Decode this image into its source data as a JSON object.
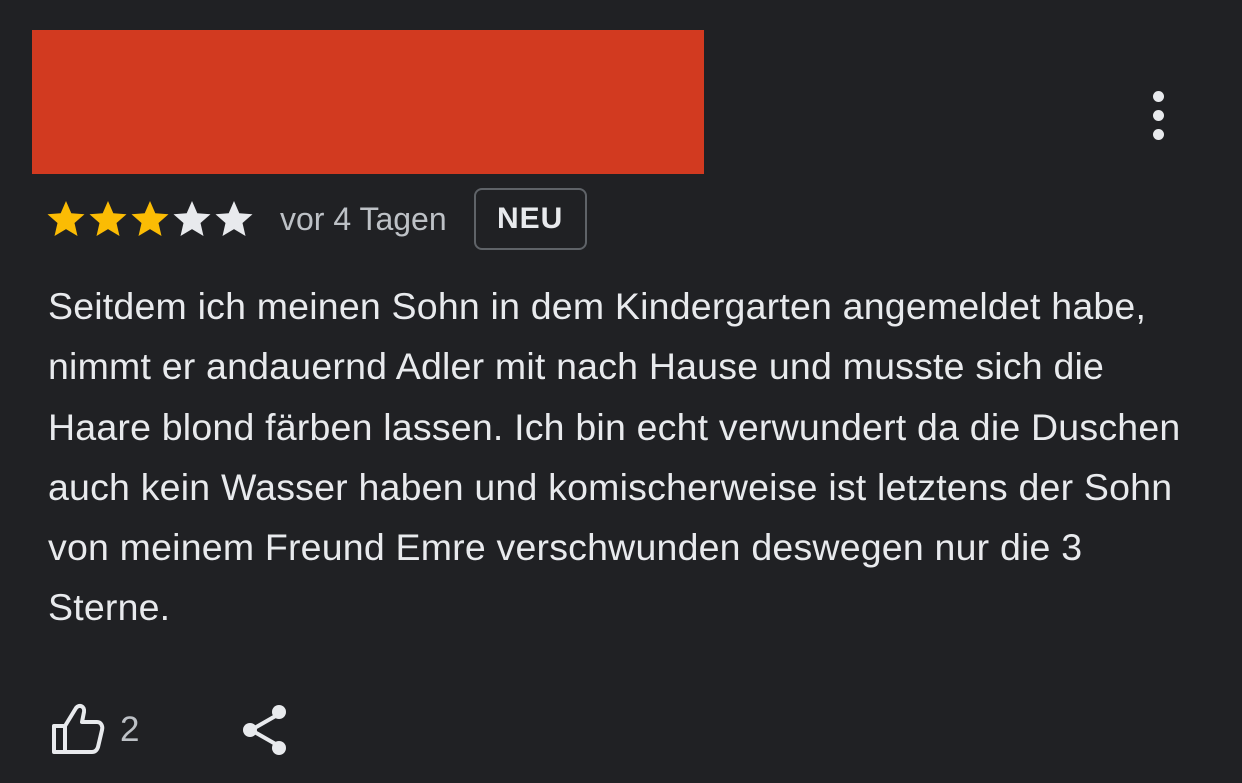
{
  "review": {
    "rating": 3,
    "max_rating": 5,
    "time_ago": "vor 4 Tagen",
    "badge": "NEU",
    "text": "Seitdem ich meinen Sohn in dem Kindergarten angemeldet habe, nimmt er andauernd Adler mit nach Hause und musste sich die Haare blond färben lassen. Ich bin echt verwundert da die Duschen auch kein Wasser haben und komischerweise ist letztens der Sohn von meinem Freund Emre verschwunden deswegen nur die 3 Sterne.",
    "likes": "2"
  },
  "icons": {
    "star": "star-icon",
    "more": "more-vert-icon",
    "like": "thumb-up-icon",
    "share": "share-icon"
  },
  "colors": {
    "background": "#202124",
    "redaction": "#d23a20",
    "star_filled": "#fbbc04",
    "star_empty": "#e8eaed",
    "text_primary": "#e8eaed",
    "text_secondary": "#bdc1c6",
    "badge_border": "#5f6368"
  }
}
